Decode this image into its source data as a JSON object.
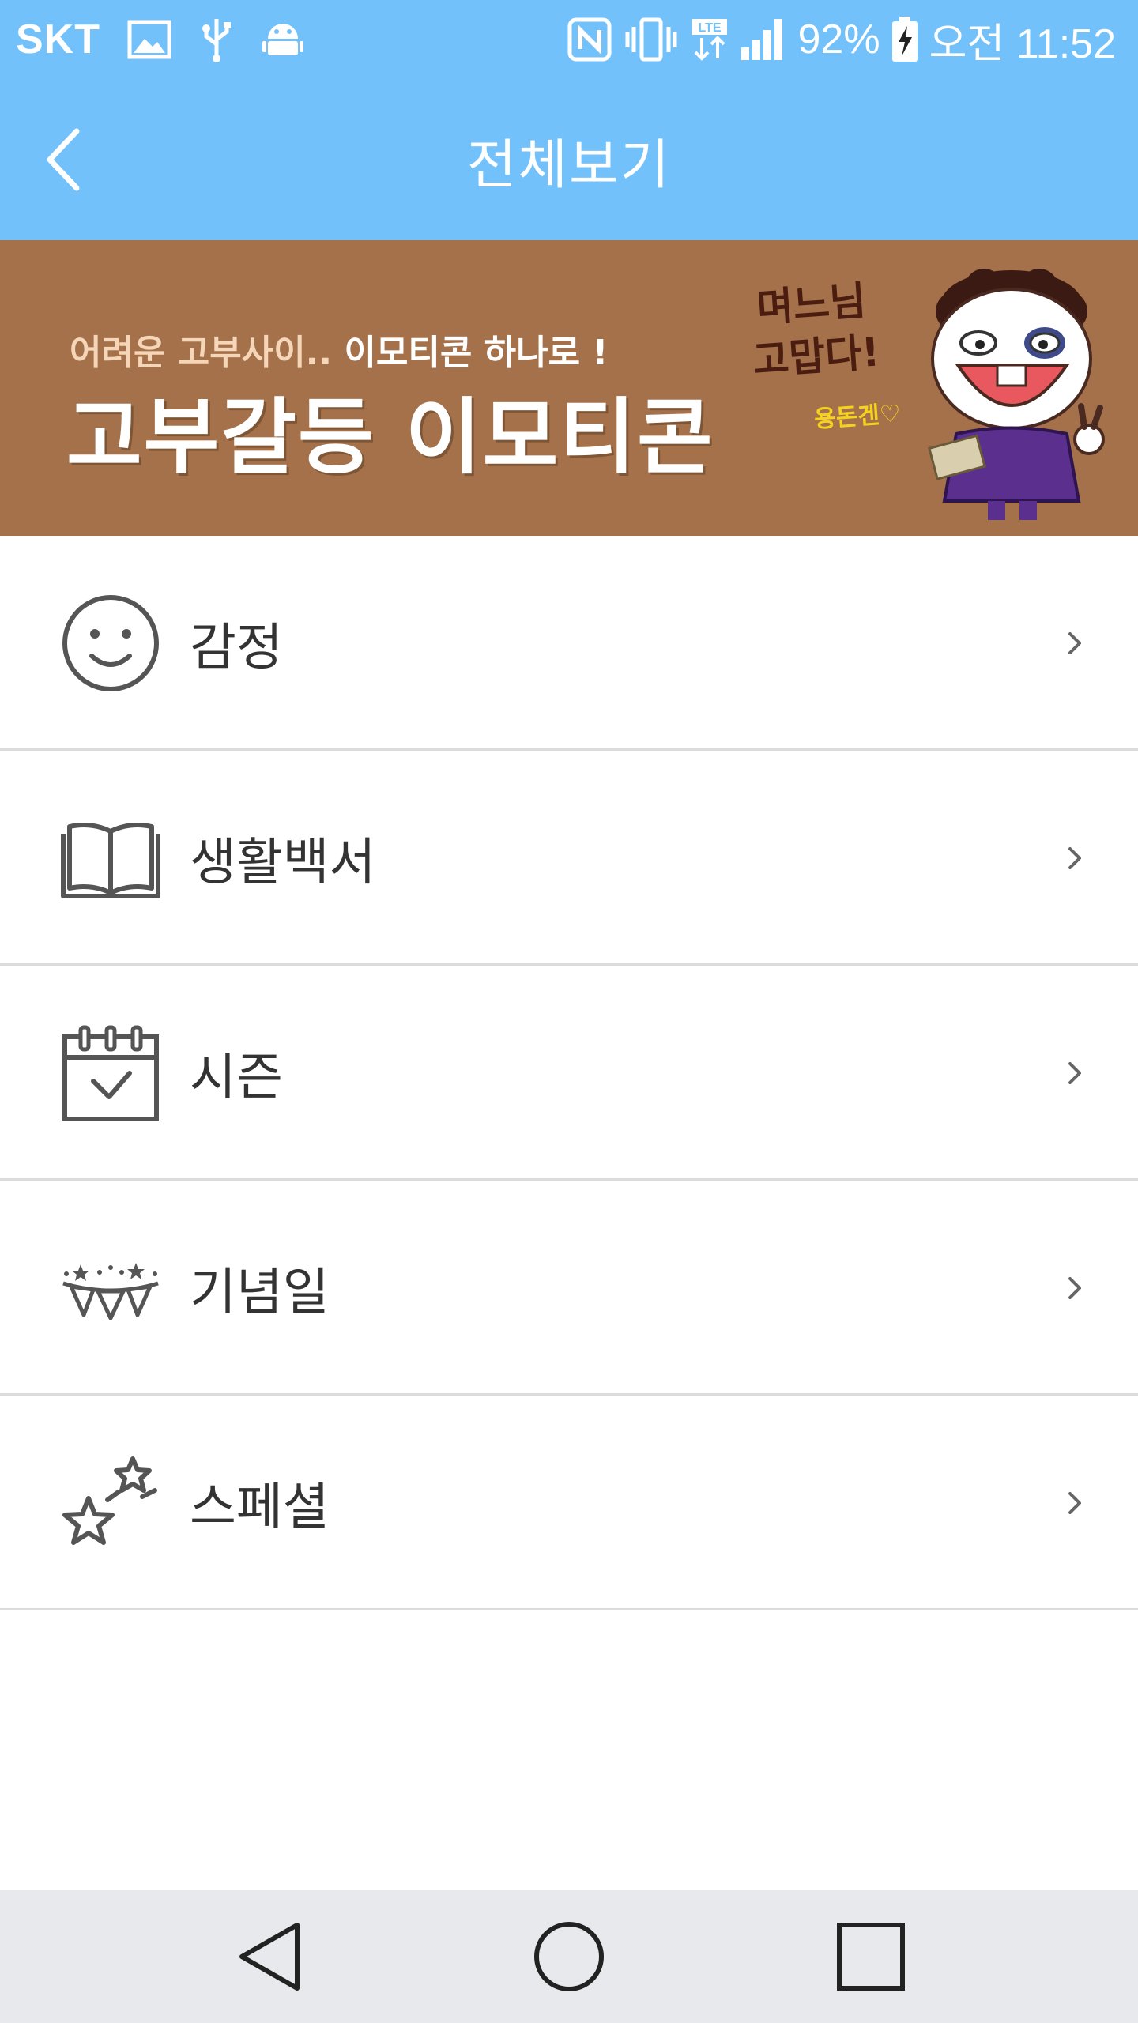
{
  "status_bar": {
    "carrier": "SKT",
    "battery_percent": "92%",
    "time": "오전 11:52",
    "icons": [
      "gallery-icon",
      "usb-icon",
      "android-icon",
      "nfc-icon",
      "vibrate-icon",
      "lte-icon",
      "signal-icon",
      "battery-charging-icon"
    ]
  },
  "app_bar": {
    "title": "전체보기",
    "back_icon": "back-arrow-icon"
  },
  "banner": {
    "subtitle_plain": "어려운 고부사이.. ",
    "subtitle_highlight": "이모티콘 하나로 !",
    "main_title": "고부갈등 이모티콘",
    "handwritten_line1": "며느님",
    "handwritten_line2": "고맙다!",
    "signature": "용돈겐♡",
    "background_color": "#a4714a"
  },
  "menu": {
    "items": [
      {
        "label": "감정",
        "icon": "smiley-face-icon"
      },
      {
        "label": "생활백서",
        "icon": "open-book-icon"
      },
      {
        "label": "시즌",
        "icon": "calendar-check-icon"
      },
      {
        "label": "기념일",
        "icon": "party-bunting-icon"
      },
      {
        "label": "스페셜",
        "icon": "stars-icon"
      }
    ],
    "chevron_icon": "chevron-right-icon"
  },
  "nav_bar": {
    "buttons": [
      "back-triangle-icon",
      "home-circle-icon",
      "recents-square-icon"
    ]
  },
  "colors": {
    "accent": "#73c1fb",
    "icon_gray": "#555555",
    "divider": "#dcdcdc",
    "nav_bg": "#e8e9ec"
  }
}
